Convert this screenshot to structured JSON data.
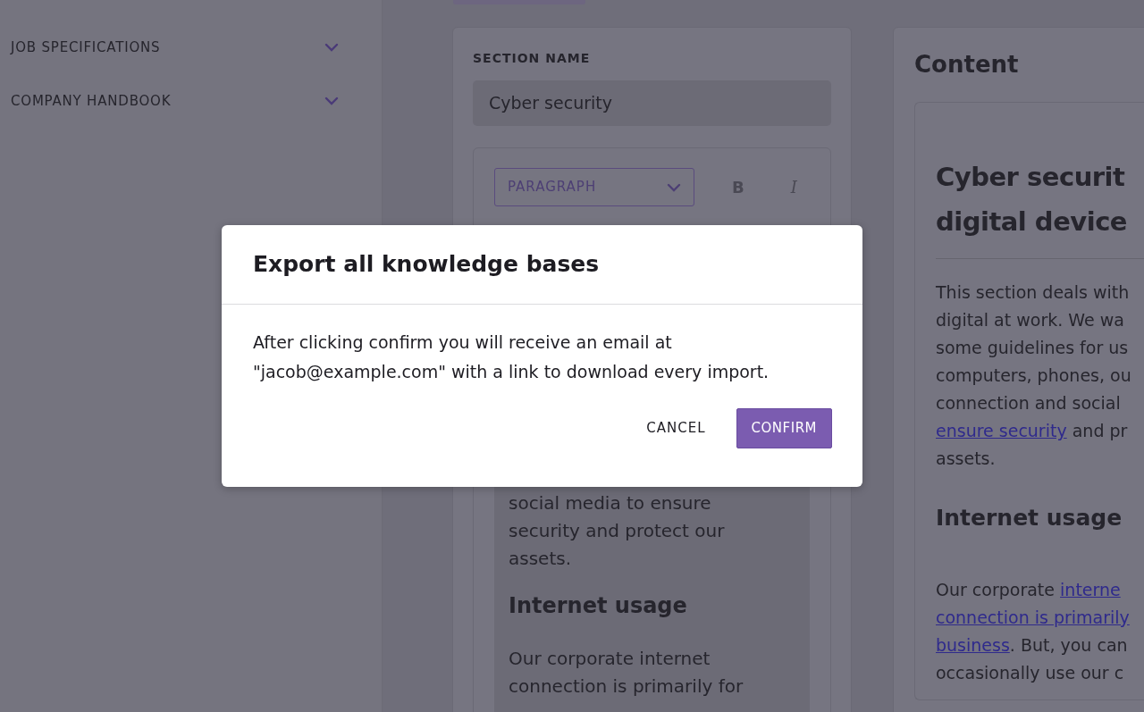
{
  "sidebar": {
    "items": [
      {
        "label": "JOB SPECIFICATIONS",
        "expanded": false
      },
      {
        "label": "COMPANY HANDBOOK",
        "expanded": false
      }
    ]
  },
  "editor": {
    "section_label": "SECTION NAME",
    "section_name": "Cyber security",
    "block_select": "PARAGRAPH",
    "bold_button": "B",
    "italic_button": "I",
    "content": [
      {
        "kind": "line",
        "text": "social media to ensure"
      },
      {
        "kind": "line",
        "text": "security and protect our"
      },
      {
        "kind": "line",
        "text": "assets."
      },
      {
        "kind": "heading",
        "text": "Internet usage"
      },
      {
        "kind": "line",
        "text": "Our corporate internet"
      },
      {
        "kind": "line",
        "text": "connection is primarily for"
      }
    ]
  },
  "preview": {
    "title": "Content",
    "heading_lines": [
      "Cyber securit",
      "digital device"
    ],
    "blocks": [
      {
        "kind": "paragraph",
        "lines": [
          [
            {
              "text": "This section deals with",
              "link": false
            }
          ],
          [
            {
              "text": "digital at work. We wa",
              "link": false
            }
          ],
          [
            {
              "text": "some guidelines for us",
              "link": false
            }
          ],
          [
            {
              "text": "computers, phones, ou",
              "link": false
            }
          ],
          [
            {
              "text": "connection and social",
              "link": false
            }
          ],
          [
            {
              "text": "ensure security",
              "link": true
            },
            {
              "text": " and pr",
              "link": false
            }
          ],
          [
            {
              "text": "assets.",
              "link": false
            }
          ]
        ]
      },
      {
        "kind": "heading",
        "text": "Internet usage"
      },
      {
        "kind": "paragraph",
        "lines": [
          [
            {
              "text": "Our corporate ",
              "link": false
            },
            {
              "text": "interne",
              "link": true
            }
          ],
          [
            {
              "text": "connection is primarily",
              "link": true
            }
          ],
          [
            {
              "text": "business",
              "link": true
            },
            {
              "text": ". But, you can",
              "link": false
            }
          ],
          [
            {
              "text": "occasionally use our c",
              "link": false
            }
          ]
        ]
      }
    ]
  },
  "modal": {
    "title": "Export all knowledge bases",
    "message_lines": [
      "After clicking confirm you will receive an email at",
      "\"jacob@example.com\" with a link to download every import."
    ],
    "buttons": [
      {
        "label": "CANCEL",
        "kind": "text"
      },
      {
        "label": "CONFIRM",
        "kind": "primary"
      }
    ]
  }
}
